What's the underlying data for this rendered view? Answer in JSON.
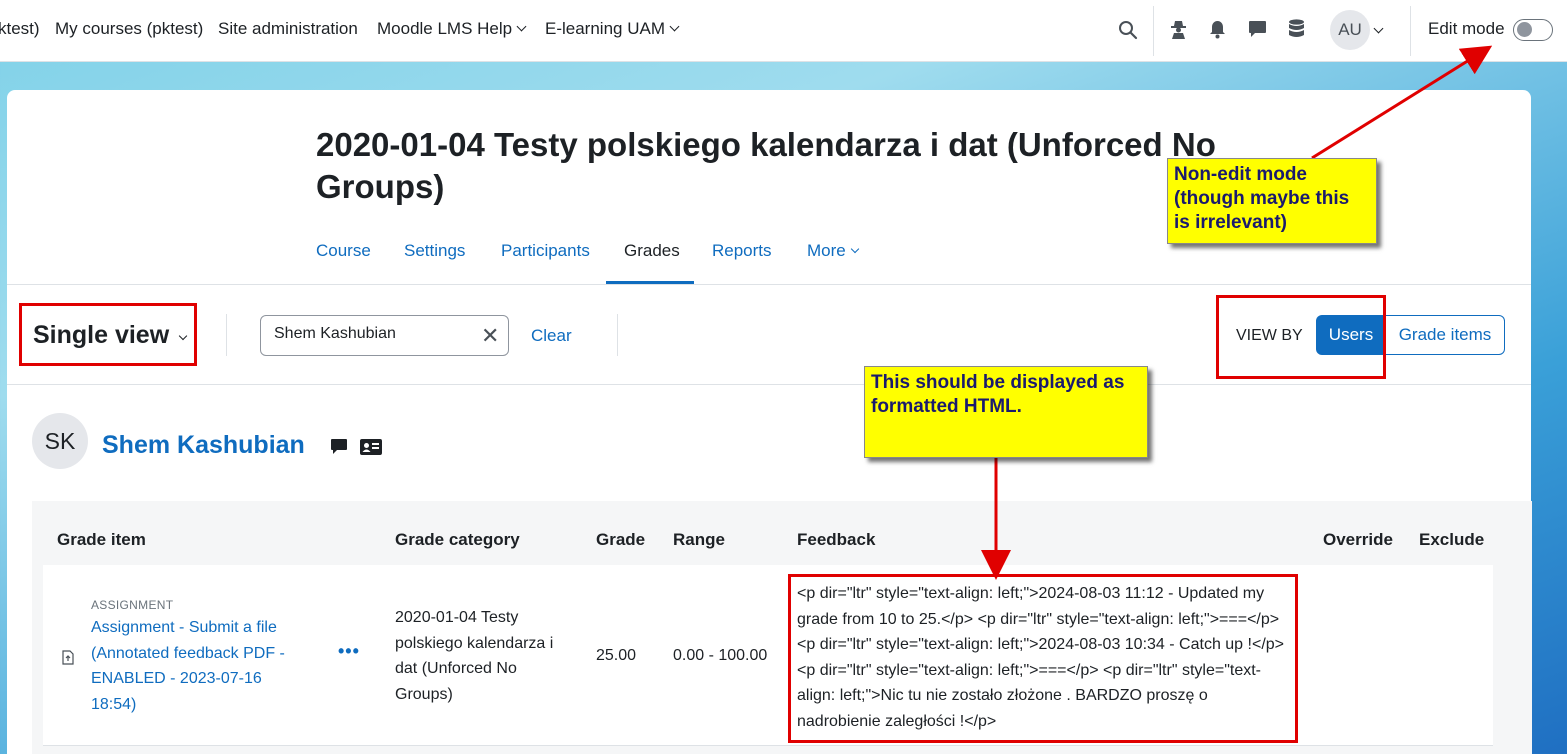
{
  "navbar": {
    "links": [
      {
        "label": "ktest)",
        "id": "nav-link-partial"
      },
      {
        "label": "My courses (pktest)",
        "id": "nav-link-my-courses"
      },
      {
        "label": "Site administration",
        "id": "nav-link-site-admin"
      },
      {
        "label": "Moodle LMS Help",
        "id": "nav-link-moodle-help"
      },
      {
        "label": "E-learning UAM",
        "id": "nav-link-elearning"
      }
    ],
    "user_initials": "AU",
    "edit_mode_label": "Edit mode",
    "edit_mode_on": false,
    "icons": [
      "search-icon",
      "accessibility-icon",
      "bell-icon",
      "chat-icon",
      "database-icon"
    ]
  },
  "course": {
    "title": "2020-01-04 Testy polskiego kalendarza i dat (Unforced No Groups)"
  },
  "tabs": [
    {
      "label": "Course",
      "active": false
    },
    {
      "label": "Settings",
      "active": false
    },
    {
      "label": "Participants",
      "active": false
    },
    {
      "label": "Grades",
      "active": true
    },
    {
      "label": "Reports",
      "active": false
    },
    {
      "label": "More",
      "active": false
    }
  ],
  "toolbar": {
    "view_selector": "Single view",
    "search_value": "Shem Kashubian",
    "clear_label": "Clear",
    "view_by_label": "VIEW BY",
    "view_by_users": "Users",
    "view_by_grade_items": "Grade items"
  },
  "user": {
    "initials": "SK",
    "name": "Shem Kashubian"
  },
  "table": {
    "headers": [
      "Grade item",
      "Grade category",
      "Grade",
      "Range",
      "Feedback",
      "Override",
      "Exclude"
    ],
    "rows": [
      {
        "type_label": "ASSIGNMENT",
        "item": "Assignment - Submit a file (Annotated feedback PDF - ENABLED - 2023-07-16 18:54)",
        "category": "2020-01-04 Testy polskiego kalendarza i dat (Unforced No Groups)",
        "grade": "25.00",
        "range": "0.00 - 100.00",
        "feedback": "<p dir=\"ltr\" style=\"text-align: left;\">2024-08-03 11:12 - Updated my grade from 10 to 25.</p> <p dir=\"ltr\" style=\"text-align: left;\">===</p> <p dir=\"ltr\" style=\"text-align: left;\">2024-08-03 10:34 - Catch up !</p> <p dir=\"ltr\" style=\"text-align: left;\">===</p> <p dir=\"ltr\" style=\"text-align: left;\">Nic tu nie zostało złożone . BARDZO proszę o nadrobienie zaległości !</p>"
      }
    ]
  },
  "annotations": {
    "edit_mode_note": "Non-edit mode (though maybe this is irrelevant)",
    "feedback_note": "This should be displayed as formatted HTML.",
    "note_color": "#ffff00",
    "box_color": "#e00000"
  },
  "colors": {
    "primary": "#0f6cbf",
    "text": "#1d2125"
  }
}
